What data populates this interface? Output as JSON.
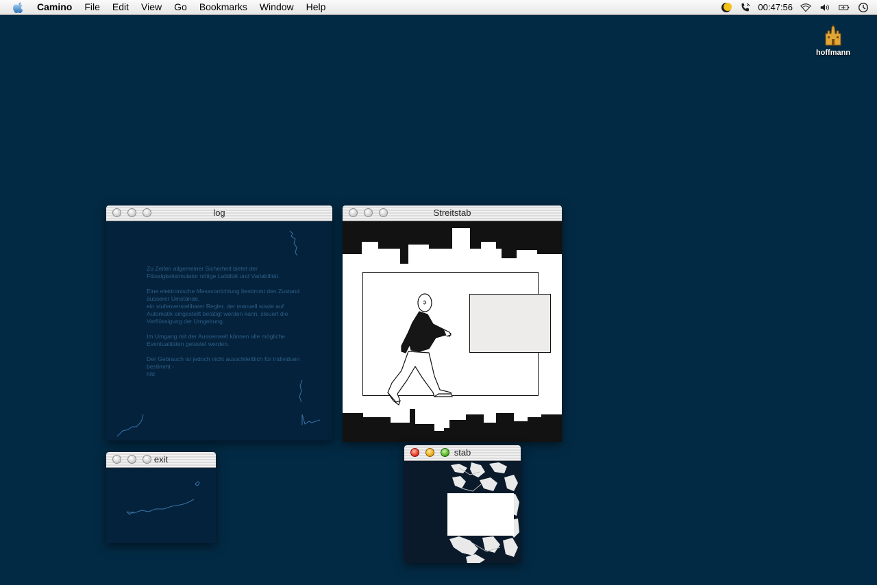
{
  "menubar": {
    "app_name": "Camino",
    "items": [
      "File",
      "Edit",
      "View",
      "Go",
      "Bookmarks",
      "Window",
      "Help"
    ],
    "clock": "00:47:56",
    "status_icons": [
      "moon-icon",
      "phone-icon",
      "wifi-icon",
      "volume-icon",
      "battery-icon",
      "clock-icon"
    ]
  },
  "desktop": {
    "background": "#032a44",
    "hd_label": "hoffmann"
  },
  "windows": {
    "log": {
      "title": "log",
      "text": "Zu Zeiten allgemeiner Sicherheit bietet der Flüssigkeitsimulator nötige Labilität und Variabilität.\n\nEine elektronische Messvorrichtung bestimmt den Zustand äusserer Umstände,\nein stufenverstellbarer Regler, der manuell sowie auf Automatik eingestellt betätigt werden kann, steuert die Verflüssigung der Umgebung.\n\nIm Umgang mit der Aussenwelt können alle mögliche Eventualitäten getestet werden.\n\nDer Gebrauch ist jedoch nicht ausschließlich für Individuen bestimmt -\nhfd"
    },
    "streitstab": {
      "title": "Streitstab"
    },
    "exit": {
      "title": "exit"
    },
    "stab": {
      "title": "stab"
    }
  },
  "colors": {
    "menubar_bg": "#ececec",
    "window_dark_bg": "#04223c",
    "log_text": "#2d5e86",
    "doodle_stroke": "#3a73a8"
  }
}
